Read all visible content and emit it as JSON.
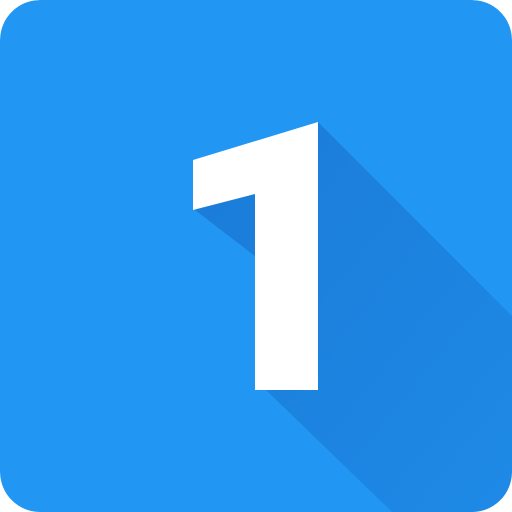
{
  "icon": {
    "name": "number-one-icon",
    "number": "1",
    "colors": {
      "background": "#2196F3",
      "glyph": "#FFFFFF",
      "shadow": "#1565C0"
    }
  }
}
